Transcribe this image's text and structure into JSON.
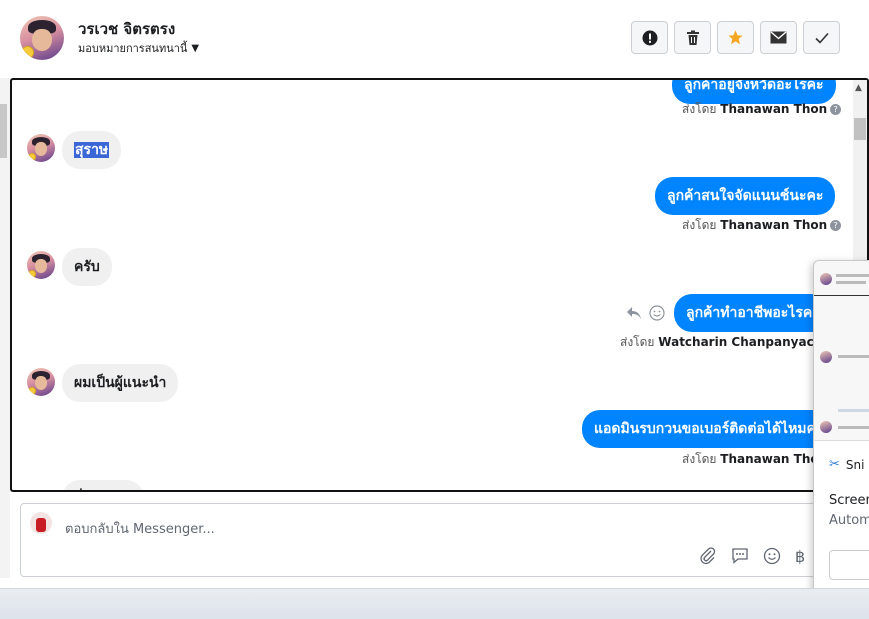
{
  "header": {
    "name": "วรเวช จิตรตรง",
    "assign_label": "มอบหมายการสนทนานี้",
    "actions": [
      {
        "name": "spam-button",
        "icon": "exclamation-icon",
        "glyph": "!"
      },
      {
        "name": "delete-button",
        "icon": "trash-icon",
        "glyph": "🗑"
      },
      {
        "name": "star-button",
        "icon": "star-icon",
        "glyph": "★"
      },
      {
        "name": "mark-unread-button",
        "icon": "envelope-icon",
        "glyph": "✉"
      },
      {
        "name": "mark-done-button",
        "icon": "checkmark-icon",
        "glyph": "✓"
      }
    ]
  },
  "messages": {
    "top_cut_text": "ลูกค้าอยู่จังหวัดอะไรคะ",
    "top_sender_prefix": "ส่งโดย",
    "top_sender_name": "Thanawan Thon",
    "msg1": "สุราษ",
    "msg2": "ลูกค้าสนใจจัดแนนช์นะคะ",
    "msg2_sender_prefix": "ส่งโดย",
    "msg2_sender_name": "Thanawan Thon",
    "msg3": "ครับ",
    "msg4": "ลูกค้าทำอาชีพอะไรคะ",
    "msg4_sender_prefix": "ส่งโดย",
    "msg4_sender_name": "Watcharin Chanpanyachon",
    "msg5": "ผมเป็นผู้แนะนำ",
    "msg6": "แอดมินรบกวนขอเบอร์ติดต่อได้ไหมคะ",
    "msg6_sender_prefix": "ส่งโดย",
    "msg6_sender_name": "Thanawan Thon",
    "msg7_cut": "ชื่อ...ไม่รู้"
  },
  "composer": {
    "placeholder": "ตอบกลับใน Messenger..."
  },
  "popup": {
    "title": "Sni",
    "line1": "Screen",
    "line2": "Autom"
  },
  "colors": {
    "outgoing_bubble": "#0084ff",
    "incoming_bubble": "#f1f0f0",
    "highlight": "#3a66d6",
    "star": "#f5a623"
  }
}
